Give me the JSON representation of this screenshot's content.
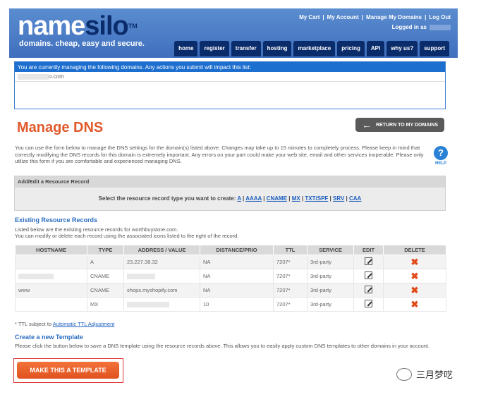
{
  "header": {
    "logo_part1": "name",
    "logo_part2": "silo",
    "logo_tm": "TM",
    "tagline": "domains. cheap, easy and secure.",
    "toplinks": [
      "My Cart",
      "My Account",
      "Manage My Domains",
      "Log Out"
    ],
    "logged_in": "Logged in as",
    "nav": [
      "home",
      "register",
      "transfer",
      "hosting",
      "marketplace",
      "pricing",
      "API",
      "why us?",
      "support"
    ]
  },
  "managing": {
    "bar_text": "You are currently managing the following domains. Any actions you submit will impact this list:",
    "domain_suffix": "o.com"
  },
  "page_title": "Manage DNS",
  "return_button": "RETURN TO MY DOMAINS",
  "intro": "You can use the form below to manage the DNS settings for the domain(s) listed above. Changes may take up to 15 minutes to completely process. Please keep in mind that correctly modifying the DNS records for this domain is extremely important. Any errors on your part could make your web site, email and other services inoperable. Please only utilize this form if you are comfortable and experienced managing DNS.",
  "help_label": "HELP",
  "add_edit": {
    "header": "Add/Edit a Resource Record",
    "prompt": "Select the resource record type you want to create:",
    "types": [
      "A",
      "AAAA",
      "CNAME",
      "MX",
      "TXT/SPF",
      "SRV",
      "CAA"
    ]
  },
  "existing": {
    "heading": "Existing Resource Records",
    "desc1": "Listed below are the existing resource records for worthbuystore.com.",
    "desc2": "You can modify or delete each record using the associated icons listed to the right of the record.",
    "columns": [
      "HOSTNAME",
      "TYPE",
      "ADDRESS / VALUE",
      "DISTANCE/PRIO",
      "TTL",
      "SERVICE",
      "EDIT",
      "DELETE"
    ],
    "rows": [
      {
        "hostname": "",
        "type": "A",
        "value": "23.227.38.32",
        "prio": "NA",
        "ttl": "7207*",
        "service": "3rd-party"
      },
      {
        "hostname": "",
        "type": "CNAME",
        "value": "",
        "prio": "NA",
        "ttl": "7207*",
        "service": "3rd-party"
      },
      {
        "hostname": "www",
        "type": "CNAME",
        "value": "shops.myshopify.com",
        "prio": "NA",
        "ttl": "7207*",
        "service": "3rd-party"
      },
      {
        "hostname": "",
        "type": "MX",
        "value": "",
        "prio": "10",
        "ttl": "7207*",
        "service": "3rd-party"
      }
    ]
  },
  "ttl_note_prefix": "* TTL subject to ",
  "ttl_note_link": "Automatic TTL Adjustment",
  "template": {
    "heading": "Create a new Template",
    "desc": "Please click the button below to save a DNS template using the resource records above. This allows you to easily apply custom DNS templates to other domains in your account.",
    "button": "MAKE THIS A TEMPLATE"
  },
  "watermark": "三月梦呓"
}
